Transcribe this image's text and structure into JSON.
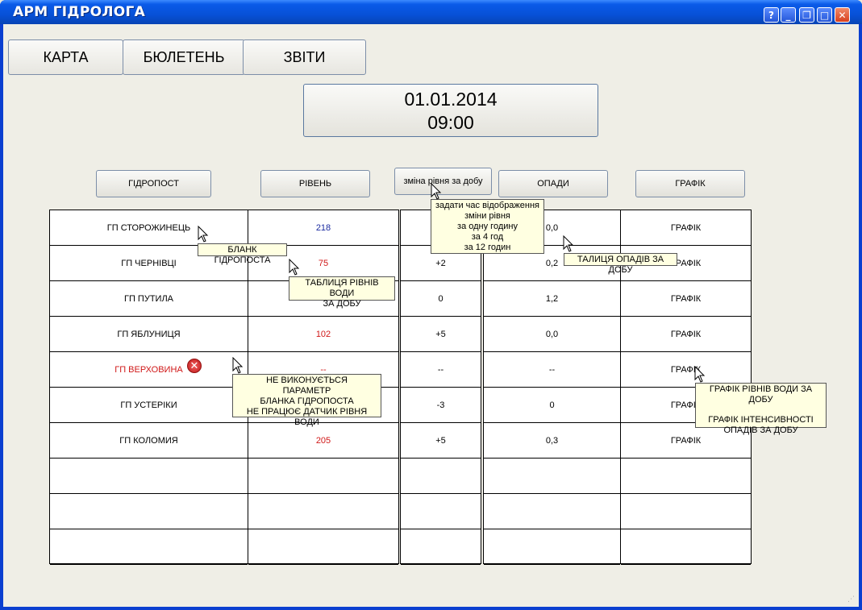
{
  "window": {
    "title": "АРМ ГІДРОЛОГА",
    "controls": [
      "?",
      "_",
      "❐",
      "□",
      "✕"
    ]
  },
  "nav": {
    "map": "КАРТА",
    "bulletin": "БЮЛЕТЕНЬ",
    "reports": "ЗВІТИ"
  },
  "datetime": {
    "date": "01.01.2014",
    "time": "09:00"
  },
  "headers": {
    "post": "ГІДРОПОСТ",
    "level": "РІВЕНЬ",
    "change": "зміна рівня за добу",
    "precip": "ОПАДИ",
    "graph": "ГРАФІК"
  },
  "rows": [
    {
      "post": "ГП СТОРОЖИНЕЦЬ",
      "level": "218",
      "change": "",
      "precip": "0,0",
      "graph": "ГРАФІК"
    },
    {
      "post": "ГП ЧЕРНІВЦІ",
      "level": "75",
      "change": "+2",
      "precip": "0,2",
      "graph": "ГРАФІК"
    },
    {
      "post": "ГП ПУТИЛА",
      "level": "",
      "change": "0",
      "precip": "1,2",
      "graph": "ГРАФІК"
    },
    {
      "post": "ГП ЯБЛУНИЦЯ",
      "level": "102",
      "change": "+5",
      "precip": "0,0",
      "graph": "ГРАФІК"
    },
    {
      "post": "ГП ВЕРХОВИНА",
      "level": "--",
      "change": "--",
      "precip": "--",
      "graph": "ГРАФІК"
    },
    {
      "post": "ГП УСТЕРІКИ",
      "level": "",
      "change": "-3",
      "precip": "0",
      "graph": "ГРАФІК"
    },
    {
      "post": "ГП КОЛОМИЯ",
      "level": "205",
      "change": "+5",
      "precip": "0,3",
      "graph": "ГРАФІК"
    },
    {
      "post": "",
      "level": "",
      "change": "",
      "precip": "",
      "graph": ""
    },
    {
      "post": "",
      "level": "",
      "change": "",
      "precip": "",
      "graph": ""
    },
    {
      "post": "",
      "level": "",
      "change": "",
      "precip": "",
      "graph": ""
    }
  ],
  "colors": {
    "level_blue": "#1a2aa0",
    "level_red": "#d01818",
    "error_text": "#d01818"
  },
  "tooltips": {
    "change_time": [
      "задати час відображення",
      "зміни рівня",
      "за одну годину",
      "за 4 год",
      "за 12 годин"
    ],
    "post_form": "БЛАНК ГІДРОПОСТА",
    "level_table": [
      "ТАБЛИЦЯ РІВНІВ ВОДИ",
      "ЗА ДОБУ"
    ],
    "precip_table": "ТАЛИЦЯ ОПАДІВ ЗА ДОБУ",
    "error": [
      "НЕ ВИКОНУЄТЬСЯ",
      "ПАРАМЕТР",
      "БЛАНКА ГІДРОПОСТА",
      "НЕ ПРАЦЮЄ ДАТЧИК РІВНЯ ВОДИ"
    ],
    "graph": [
      "ГРАФІК РІВНІВ ВОДИ ЗА ДОБУ",
      "",
      "ГРАФІК ІНТЕНСИВНОСТІ",
      "ОПАДІВ ЗА ДОБУ"
    ]
  }
}
